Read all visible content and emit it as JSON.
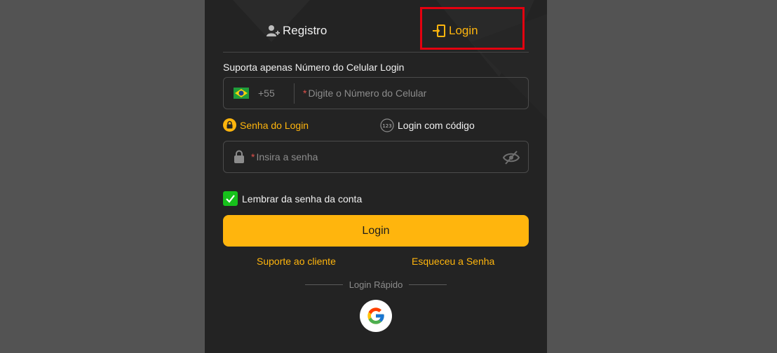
{
  "tabs": {
    "register_label": "Registro",
    "login_label": "Login",
    "active": "login"
  },
  "form": {
    "hint": "Suporta apenas Número do Celular Login",
    "phone": {
      "country_code": "+55",
      "country_flag": "brazil-flag-icon",
      "required_mark": "*",
      "placeholder": "Digite o Número do Celular"
    },
    "methods": {
      "password_label": "Senha do Login",
      "code_label": "Login com código",
      "code_icon_text": "123",
      "active": "password"
    },
    "password": {
      "required_mark": "*",
      "placeholder": "Insira a senha"
    },
    "remember": {
      "label": "Lembrar da senha da conta",
      "checked": true
    },
    "submit_label": "Login"
  },
  "links": {
    "support": "Suporte ao cliente",
    "forgot": "Esqueceu a Senha"
  },
  "quick_login": {
    "label": "Login Rápido",
    "providers": [
      "google-icon"
    ]
  },
  "colors": {
    "accent": "#ffb50d",
    "panel": "#232323",
    "backdrop": "#535353",
    "check": "#16c11b",
    "highlight": "#e4000f"
  }
}
